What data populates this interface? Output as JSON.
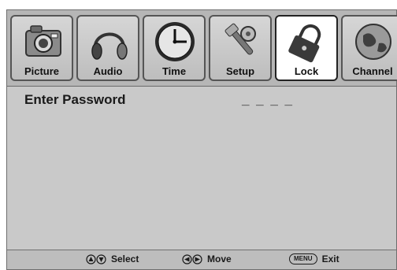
{
  "tabs": [
    {
      "id": "picture",
      "label": "Picture",
      "icon": "camera-icon",
      "active": false
    },
    {
      "id": "audio",
      "label": "Audio",
      "icon": "headphones-icon",
      "active": false
    },
    {
      "id": "time",
      "label": "Time",
      "icon": "clock-icon",
      "active": false
    },
    {
      "id": "setup",
      "label": "Setup",
      "icon": "tools-icon",
      "active": false
    },
    {
      "id": "lock",
      "label": "Lock",
      "icon": "lock-icon",
      "active": true
    },
    {
      "id": "channel",
      "label": "Channel",
      "icon": "globe-icon",
      "active": false
    }
  ],
  "content": {
    "prompt": "Enter Password",
    "password_mask": "_ _ _ _"
  },
  "footer": {
    "select_label": "Select",
    "move_label": "Move",
    "menu_key": "MENU",
    "exit_label": "Exit"
  },
  "colors": {
    "panel": "#c9c9c9",
    "tabbar": "#b6b6b6",
    "active_tab": "#ffffff",
    "text": "#1a1a1a"
  }
}
